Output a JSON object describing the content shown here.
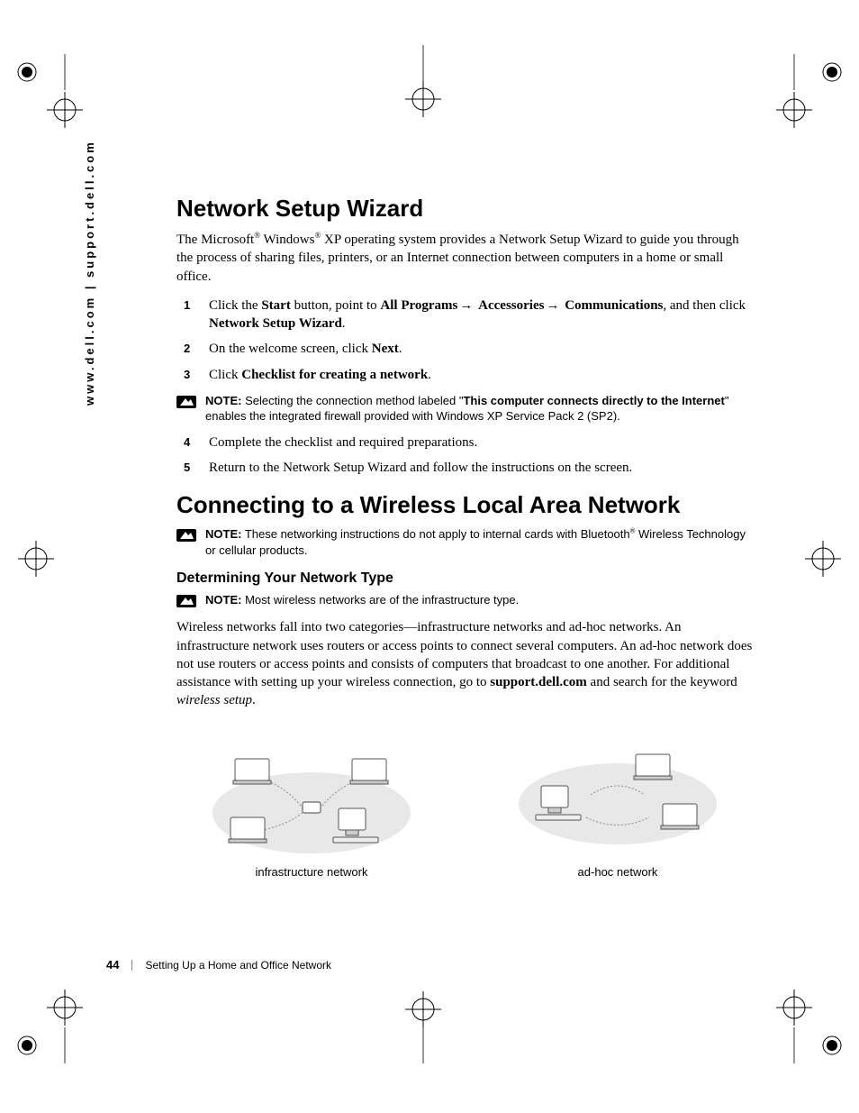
{
  "side_label": "www.dell.com | support.dell.com",
  "h1_a": "Network Setup Wizard",
  "intro_a_pre": "The Microsoft",
  "reg": "®",
  "intro_a_mid": " Windows",
  "intro_a_post": " XP operating system provides a Network Setup Wizard to guide you through the process of sharing files, printers, or an Internet connection between computers in a home or small office.",
  "steps": {
    "s1_a": "Click the ",
    "s1_b": "Start",
    "s1_c": " button, point to ",
    "s1_d": "All Programs",
    "s1_e": "Accessories",
    "s1_f": "Communications",
    "s1_g": ", and then click ",
    "s1_h": "Network Setup Wizard",
    "s1_i": ".",
    "s2_a": "On the welcome screen, click ",
    "s2_b": "Next",
    "s2_c": ".",
    "s3_a": "Click ",
    "s3_b": "Checklist for creating a network",
    "s3_c": ".",
    "s4": "Complete the checklist and required preparations.",
    "s5": "Return to the Network Setup Wizard and follow the instructions on the screen."
  },
  "note1_label": "NOTE:",
  "note1_a": " Selecting the connection method labeled \"",
  "note1_b": "This computer connects directly to the Internet",
  "note1_c": "\" enables the integrated firewall provided with Windows XP Service Pack 2 (SP2).",
  "h1_b": "Connecting to a Wireless Local Area Network",
  "note2_label": "NOTE:",
  "note2_a": " These networking instructions do not apply to internal cards with Bluetooth",
  "note2_b": " Wireless Technology or cellular products.",
  "h2": "Determining Your Network Type",
  "note3_label": "NOTE:",
  "note3": " Most wireless networks are of the infrastructure type.",
  "body_a": "Wireless networks fall into two categories—infrastructure networks and ad-hoc networks. An infrastructure network uses routers or access points to connect several computers. An ad-hoc network does not use routers or access points and consists of computers that broadcast to one another. For additional assistance with setting up your wireless connection, go to ",
  "body_b": "support.dell.com",
  "body_c": " and search for the keyword ",
  "body_d": "wireless setup",
  "body_e": ".",
  "fig1_caption": "infrastructure network",
  "fig2_caption": "ad-hoc network",
  "page_num": "44",
  "footer_text": "Setting Up a Home and Office Network",
  "nums": {
    "n1": "1",
    "n2": "2",
    "n3": "3",
    "n4": "4",
    "n5": "5"
  },
  "arrow": "→"
}
